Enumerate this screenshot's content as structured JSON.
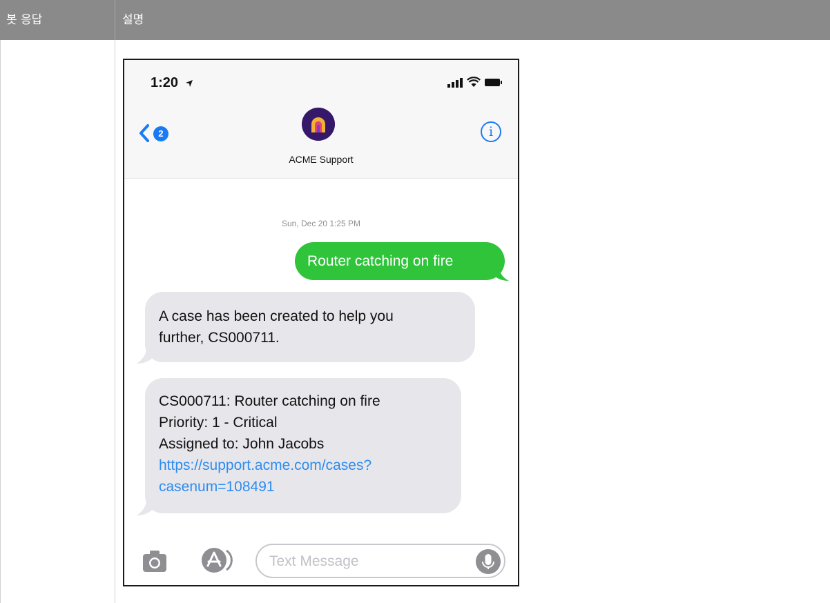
{
  "table": {
    "headers": [
      "봇 응답",
      "설명"
    ]
  },
  "phone": {
    "status_time": "1:20",
    "back_badge_count": "2",
    "contact_name": "ACME Support",
    "info_glyph": "i",
    "timestamp": "Sun, Dec 20 1:25 PM",
    "messages": {
      "sent": "Router catching on fire",
      "received_1": [
        "A case has been created to help you",
        "further, CS000711."
      ],
      "received_2": {
        "lines": [
          "CS000711: Router catching on fire",
          "Priority: 1 - Critical",
          "Assigned to: John Jacobs"
        ],
        "link_lines": [
          "https://support.acme.com/cases?",
          "casenum=108491"
        ]
      }
    },
    "input_placeholder": "Text Message"
  },
  "icons": {
    "location": "location-arrow-icon",
    "signal": "signal-bars-icon",
    "wifi": "wifi-icon",
    "battery": "battery-icon",
    "back": "chevron-left-icon",
    "info": "info-icon",
    "camera": "camera-icon",
    "apps": "app-store-icon",
    "mic": "microphone-icon"
  },
  "colors": {
    "header_bg": "#8a8a8a",
    "sent_bubble": "#2fc43a",
    "received_bubble": "#e6e6eb",
    "ios_blue": "#1a7af5",
    "link": "#2d8cf0"
  }
}
